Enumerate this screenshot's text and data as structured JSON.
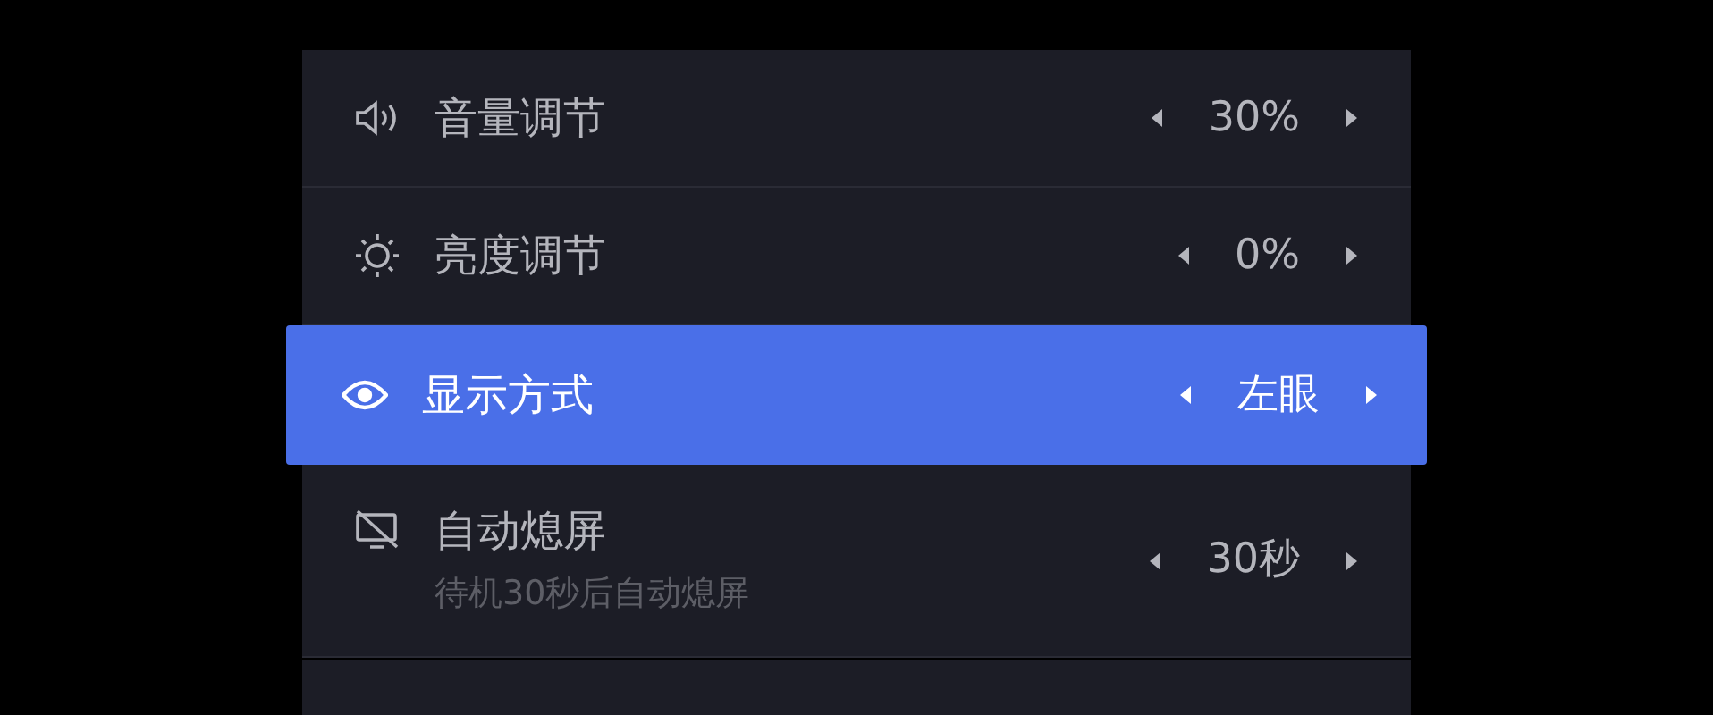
{
  "settings": [
    {
      "label": "音量调节",
      "value": "30%",
      "selected": false
    },
    {
      "label": "亮度调节",
      "value": "0%",
      "selected": false
    },
    {
      "label": "显示方式",
      "value": "左眼",
      "selected": true
    },
    {
      "label": "自动熄屏",
      "description": "待机30秒后自动熄屏",
      "value": "30秒",
      "selected": false
    }
  ]
}
